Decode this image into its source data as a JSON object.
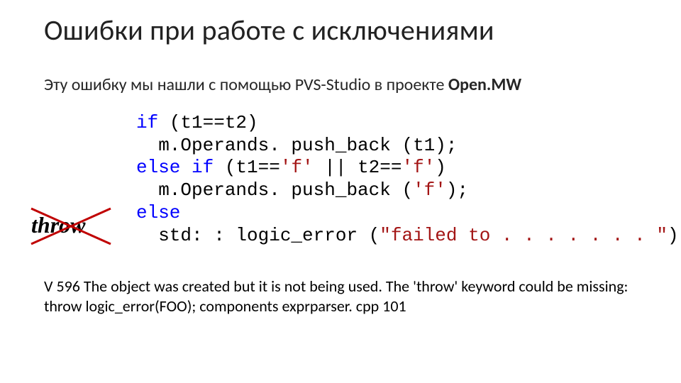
{
  "title": "Ошибки при работе с исключениями",
  "subtitle_prefix": "Эту ошибку мы нашли с помощью PVS-Studio в проекте ",
  "subtitle_project": "Open.MW",
  "throw_label": "throw",
  "code": {
    "l1_kw": "if",
    "l1_rest": " (t1==t2)",
    "l2": "  m.Operands. push_back (t1);",
    "l3_kw": "else if",
    "l3_rest": " (t1==",
    "l3_s1": "'f'",
    "l3_mid": " || t2==",
    "l3_s2": "'f'",
    "l3_end": ")",
    "l4_a": "  m.Operands. push_back (",
    "l4_s": "'f'",
    "l4_b": ");",
    "l5_kw": "else",
    "l6_a": "  std: : logic_error (",
    "l6_s": "\"failed to . . . . . . . \"",
    "l6_b": ");"
  },
  "footer": "V 596 The object was created but it is not being used. The 'throw' keyword could be missing: throw logic_error(FOO); components exprparser. cpp 101"
}
